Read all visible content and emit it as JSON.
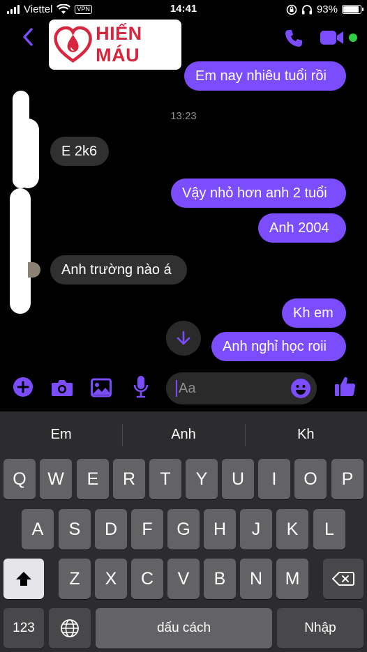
{
  "status_bar": {
    "carrier": "Viettel",
    "vpn": "VPN",
    "time": "14:41",
    "battery": "93%",
    "battery_level": 0.93
  },
  "header": {
    "logo_text": "HIẾN MÁU",
    "icons": [
      "back-icon",
      "phone-icon",
      "video-camera-icon"
    ],
    "accent_color": "#7c4dff",
    "online_color": "#31cc46"
  },
  "messages": [
    {
      "side": "out",
      "text": "Em nay nhiêu tuổi rồi"
    },
    {
      "side": "time",
      "text": "13:23"
    },
    {
      "side": "in",
      "text": "E 2k6"
    },
    {
      "side": "out",
      "text": "Vậy nhỏ hơn anh 2 tuổi"
    },
    {
      "side": "out",
      "text": "Anh 2004"
    },
    {
      "side": "in",
      "text": "Anh trường nào á"
    },
    {
      "side": "out",
      "text": "Kh em"
    },
    {
      "side": "out",
      "text": "Anh nghỉ học roii"
    }
  ],
  "composer": {
    "placeholder": "Aa",
    "icons": [
      "plus-icon",
      "camera-icon",
      "image-icon",
      "microphone-icon",
      "emoji-icon",
      "thumbs-up-icon"
    ]
  },
  "keyboard": {
    "suggestions": [
      "Em",
      "Anh",
      "Kh"
    ],
    "row1": [
      "Q",
      "W",
      "E",
      "R",
      "T",
      "Y",
      "U",
      "I",
      "O",
      "P"
    ],
    "row2": [
      "A",
      "S",
      "D",
      "F",
      "G",
      "H",
      "J",
      "K",
      "L"
    ],
    "row3": [
      "Z",
      "X",
      "C",
      "V",
      "B",
      "N",
      "M"
    ],
    "numbers_key": "123",
    "space_key": "dấu cách",
    "return_key": "Nhập"
  }
}
